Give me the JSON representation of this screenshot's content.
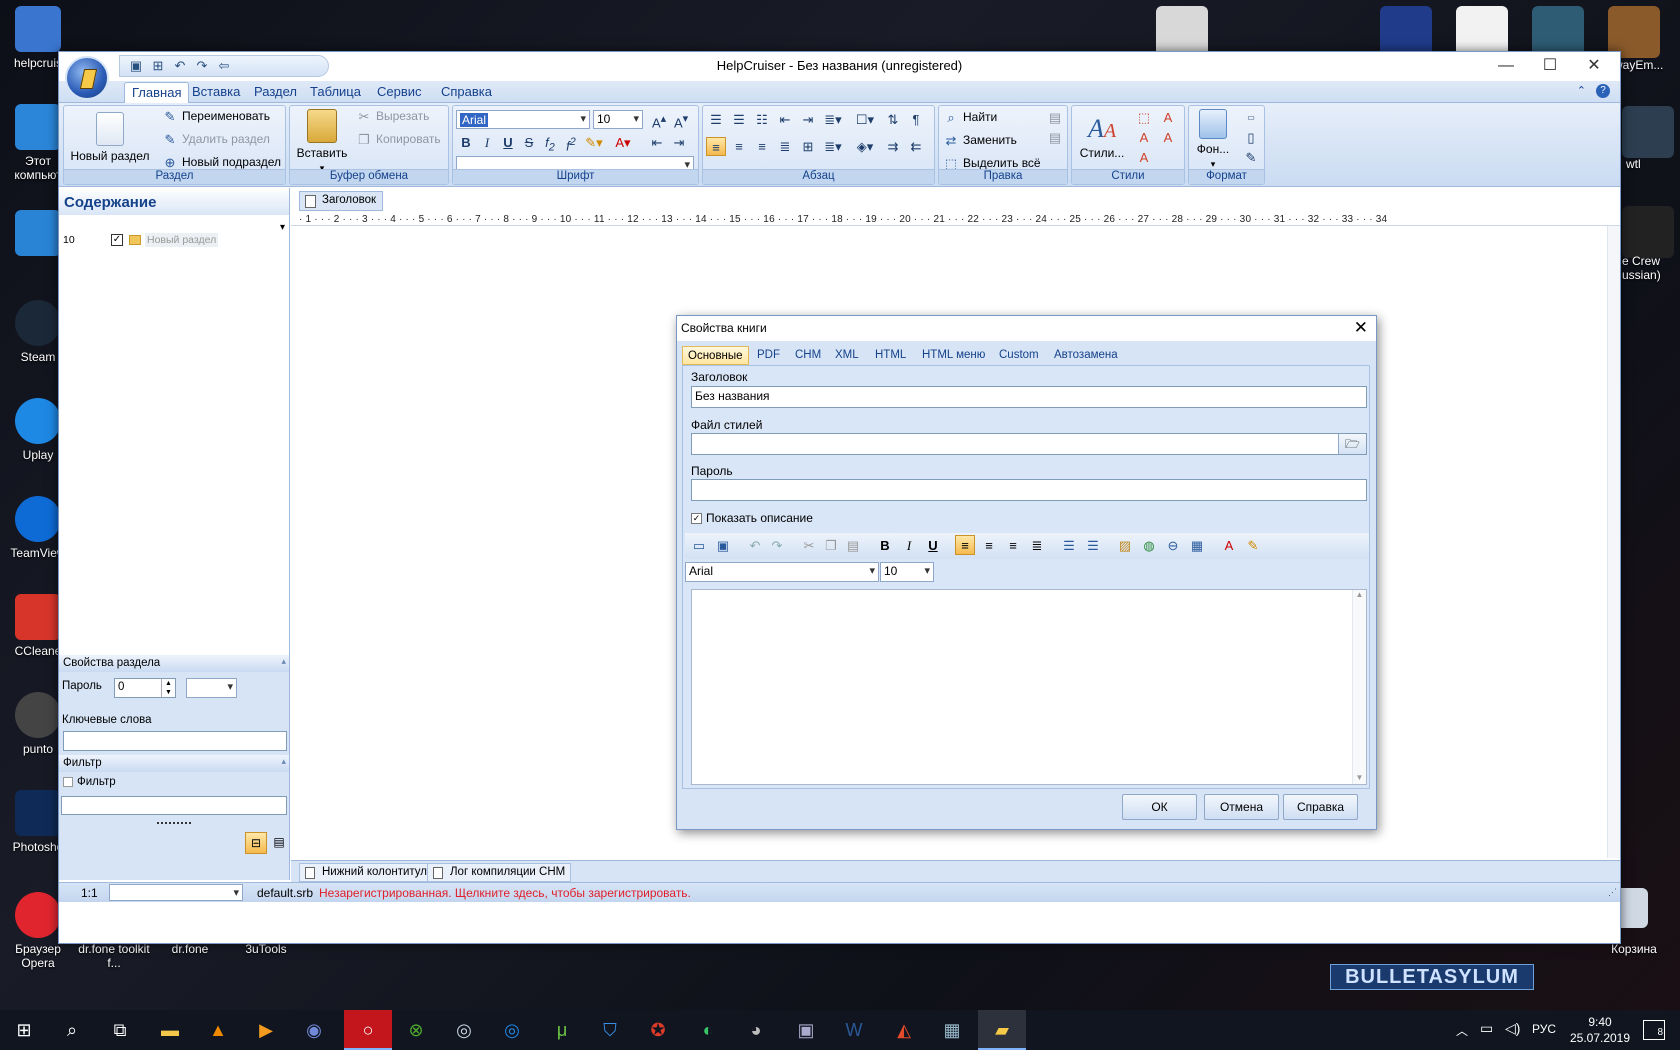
{
  "desktop": {
    "icons": [
      {
        "label": "helpcruis",
        "color": "#3a76d0"
      },
      {
        "label": "Этот компьют",
        "color": "#2b86d9"
      },
      {
        "label": "",
        "color": "#2a84d6"
      },
      {
        "label": "Steam",
        "color": "#1b2838"
      },
      {
        "label": "Uplay",
        "color": "#1e88e5"
      },
      {
        "label": "TeamView",
        "color": "#0e6bd6"
      },
      {
        "label": "CCleane",
        "color": "#d8352a"
      },
      {
        "label": "punto",
        "color": "#444444"
      },
      {
        "label": "Photosho",
        "color": "#0f2a56"
      },
      {
        "label": "Браузер Opera",
        "color": "#e0252f"
      }
    ],
    "bottom_icons": [
      "dr.fone toolkit f...",
      "dr.fone",
      "3uTools"
    ],
    "right_icons": [
      {
        "label": "wayEm...",
        "color": "#8a5a2a"
      },
      {
        "label": "wtl",
        "color": "#2c3e50"
      },
      {
        "label": "e Crew ussian)",
        "color": "#222222"
      },
      {
        "label": "Корзина",
        "color": "#cfd8e3"
      }
    ],
    "watermark": "BULLETASYLUM"
  },
  "window": {
    "title": "HelpCruiser - Без названия (unregistered)",
    "qat_icons": [
      "save-icon",
      "new-icon",
      "undo-icon",
      "redo-icon",
      "back-icon"
    ],
    "menu_tabs": [
      "Главная",
      "Вставка",
      "Раздел",
      "Таблица",
      "Сервис",
      "Справка"
    ]
  },
  "ribbon": {
    "razdel": {
      "label": "Раздел",
      "new_section": "Новый раздел",
      "rename": "Переименовать",
      "delete": "Удалить раздел",
      "new_subsection": "Новый подраздел"
    },
    "clipboard": {
      "label": "Буфер обмена",
      "paste": "Вставить",
      "cut": "Вырезать",
      "copy": "Копировать"
    },
    "font": {
      "label": "Шрифт",
      "family": "Arial",
      "size": "10"
    },
    "paragraph": {
      "label": "Абзац"
    },
    "edit": {
      "label": "Правка",
      "find": "Найти",
      "replace": "Заменить",
      "select_all": "Выделить всё"
    },
    "styles": {
      "label": "Стили",
      "styles_button": "Стили..."
    },
    "format": {
      "label": "Формат",
      "bg_button": "Фон..."
    }
  },
  "sidebar": {
    "header": "Содержание",
    "tree": [
      {
        "number": "10",
        "checked": true,
        "label": "Новый раздел"
      }
    ],
    "props_header": "Свойства раздела",
    "password_label": "Пароль",
    "password_value": "0",
    "keywords_label": "Ключевые слова",
    "filter_header": "Фильтр",
    "filter_checkbox": "Фильтр"
  },
  "content": {
    "doc_tab": "Заголовок",
    "ruler": "· 1 · · · 2 · · · 3 · · · 4 · · · 5 · · · 6 · · · 7 · · · 8 · · · 9 · · · 10 · · · 11 · · · 12 · · · 13 · · · 14 · · · 15 · · · 16 · · · 17 · · · 18 · · · 19 · · · 20 · · · 21 · · · 22 · · · 23 · · · 24 · · · 25 · · · 26 · · · 27 · · · 28 · · · 29 · · · 30 · · · 31 · · · 32 · · · 33 · · · 34",
    "bottom_tabs": [
      "Нижний колонтитул",
      "Лог компиляции CHM"
    ]
  },
  "status": {
    "zoom": "1:1",
    "file": "default.srb",
    "unregistered": "Незарегистрированная. Щелкните здесь, чтобы зарегистрировать."
  },
  "dialog": {
    "title": "Свойства книги",
    "tabs": [
      "Основные",
      "PDF",
      "CHM",
      "XML",
      "HTML",
      "HTML меню",
      "Custom",
      "Автозамена"
    ],
    "title_label": "Заголовок",
    "title_value": "Без названия",
    "stylesheet_label": "Файл стилей",
    "stylesheet_value": "",
    "password_label": "Пароль",
    "password_value": "",
    "show_desc_label": "Показать описание",
    "show_desc_checked": true,
    "editor_font": "Arial",
    "editor_size": "10",
    "ok": "ОК",
    "cancel": "Отмена",
    "help": "Справка"
  },
  "taskbar": {
    "language": "РУС",
    "time": "9:40",
    "date": "25.07.2019",
    "notifications": "8"
  }
}
